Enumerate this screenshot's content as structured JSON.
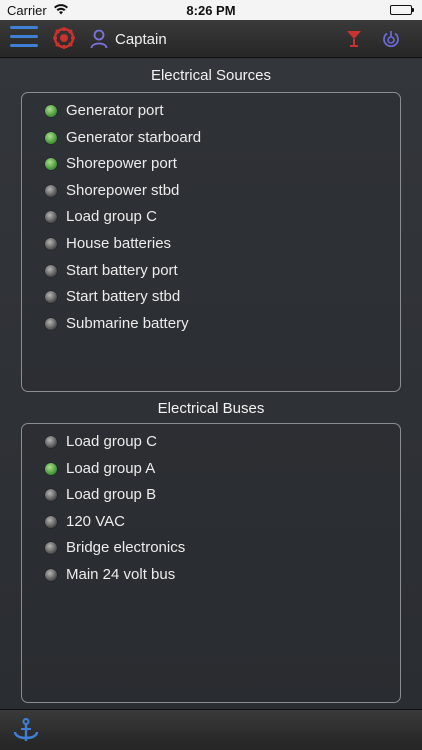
{
  "status": {
    "carrier": "Carrier",
    "time": "8:26 PM"
  },
  "nav": {
    "user": "Captain"
  },
  "sources": {
    "title": "Electrical Sources",
    "items": [
      {
        "label": "Generator port",
        "on": true
      },
      {
        "label": "Generator starboard",
        "on": true
      },
      {
        "label": "Shorepower port",
        "on": true
      },
      {
        "label": "Shorepower stbd",
        "on": false
      },
      {
        "label": "Load group C",
        "on": false
      },
      {
        "label": "House batteries",
        "on": false
      },
      {
        "label": "Start battery port",
        "on": false
      },
      {
        "label": "Start battery stbd",
        "on": false
      },
      {
        "label": "Submarine battery",
        "on": false
      }
    ]
  },
  "buses": {
    "title": "Electrical Buses",
    "items": [
      {
        "label": "Load group C",
        "on": false
      },
      {
        "label": "Load group A",
        "on": true
      },
      {
        "label": "Load group B",
        "on": false
      },
      {
        "label": "120 VAC",
        "on": false
      },
      {
        "label": "Bridge electronics",
        "on": false
      },
      {
        "label": "Main 24 volt bus",
        "on": false
      }
    ]
  },
  "colors": {
    "accent": "#3f7fd6",
    "led_on": "#4f9f40",
    "led_off": "#777777",
    "alert": "#d23a3a"
  }
}
